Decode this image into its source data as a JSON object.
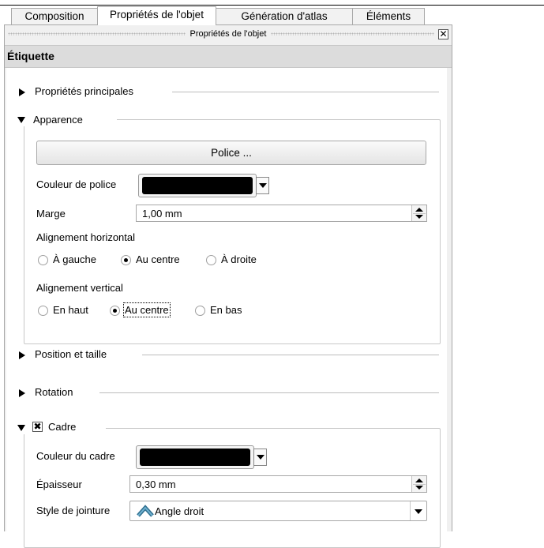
{
  "tabs": [
    {
      "label": "Composition",
      "active": false
    },
    {
      "label": "Propriétés de l'objet",
      "active": true
    },
    {
      "label": "Génération d'atlas",
      "active": false
    },
    {
      "label": "Éléments",
      "active": false
    }
  ],
  "dock": {
    "title": "Propriétés de l'objet",
    "close_glyph": "✕"
  },
  "section_title": "Étiquette",
  "groups": {
    "main_props": "Propriétés principales",
    "appearance": "Apparence",
    "position_size": "Position et taille",
    "rotation": "Rotation",
    "frame": "Cadre"
  },
  "appearance": {
    "font_button": "Police ...",
    "font_color_label": "Couleur de police",
    "font_color": "#000000",
    "margin_label": "Marge",
    "margin_value": "1,00 mm",
    "h_align_label": "Alignement horizontal",
    "h_align_options": [
      "À gauche",
      "Au centre",
      "À droite"
    ],
    "h_align_selected": "Au centre",
    "v_align_label": "Alignement vertical",
    "v_align_options": [
      "En haut",
      "Au centre",
      "En bas"
    ],
    "v_align_selected": "Au centre"
  },
  "frame": {
    "enabled": true,
    "check_glyph": "✖",
    "color_label": "Couleur du cadre",
    "color": "#000000",
    "thickness_label": "Épaisseur",
    "thickness_value": "0,30 mm",
    "join_label": "Style de jointure",
    "join_value": "Angle droit",
    "join_icon": "miter-join-icon"
  }
}
